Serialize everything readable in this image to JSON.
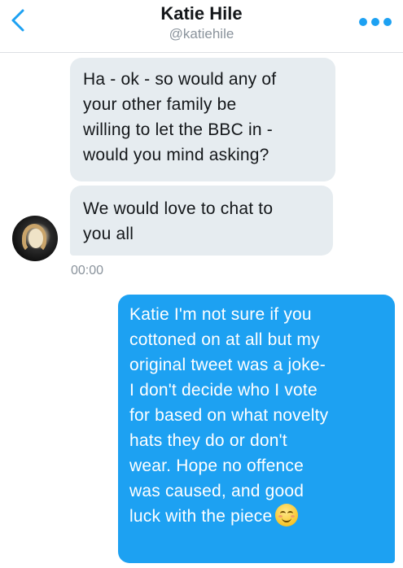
{
  "header": {
    "name": "Katie Hile",
    "handle": "@katiehile"
  },
  "messages": [
    {
      "direction": "incoming",
      "lines": [
        "Ha - ok - so would any of",
        "your other family be",
        "willing to let the BBC in -",
        "would you mind asking?"
      ]
    },
    {
      "direction": "incoming",
      "lines": [
        "We would love to chat to",
        "you all"
      ]
    },
    {
      "direction": "outgoing",
      "lines": [
        "Katie I'm not sure if you",
        "cottoned on at all but my",
        "original tweet was a joke-",
        "I don't decide who I vote",
        "for based on what novelty",
        "hats they do or don't",
        "wear. Hope no offence",
        "was caused, and good",
        "luck with the piece"
      ],
      "emoji": "smiling-face-emoji"
    }
  ],
  "timestamp": "00:00",
  "icons": {
    "back": "chevron-left-icon",
    "more": "more-dots-icon"
  },
  "colors": {
    "accent": "#1da1f2",
    "incoming_bubble": "#e6ecf0",
    "text": "#14171a",
    "muted": "#8a939c"
  }
}
